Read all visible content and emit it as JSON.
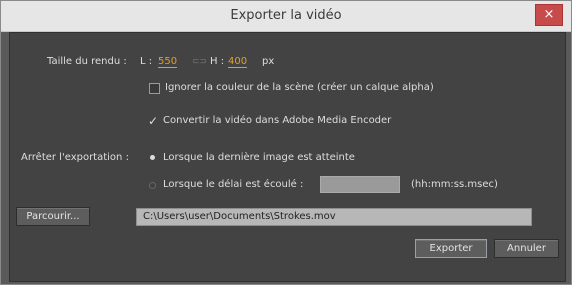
{
  "window": {
    "title": "Exporter la vidéo",
    "close_glyph": "×"
  },
  "render_size": {
    "label": "Taille du rendu :",
    "width_label": "L :",
    "width_value": "550",
    "height_label": "H :",
    "height_value": "400",
    "unit": "px",
    "link_icon": "link-icon"
  },
  "options": {
    "ignore_scene_color": {
      "checked": false,
      "label": "Ignorer la couleur de la scène (créer un calque alpha)"
    },
    "convert_video": {
      "checked": true,
      "label": "Convertir la vidéo dans Adobe Media Encoder"
    }
  },
  "stop_export": {
    "label": "Arrêter l'exportation :",
    "option_last_frame": {
      "selected": true,
      "label": "Lorsque la dernière image est atteinte"
    },
    "option_timeout": {
      "selected": false,
      "label": "Lorsque le délai est écoulé :",
      "value": "",
      "format_hint": "(hh:mm:ss.msec)"
    }
  },
  "browse": {
    "button_label": "Parcourir...",
    "path": "C:\\Users\\user\\Documents\\Strokes.mov"
  },
  "actions": {
    "export_label": "Exporter",
    "cancel_label": "Annuler"
  },
  "colors": {
    "accent": "#e09f2a",
    "close": "#c74b4b"
  }
}
